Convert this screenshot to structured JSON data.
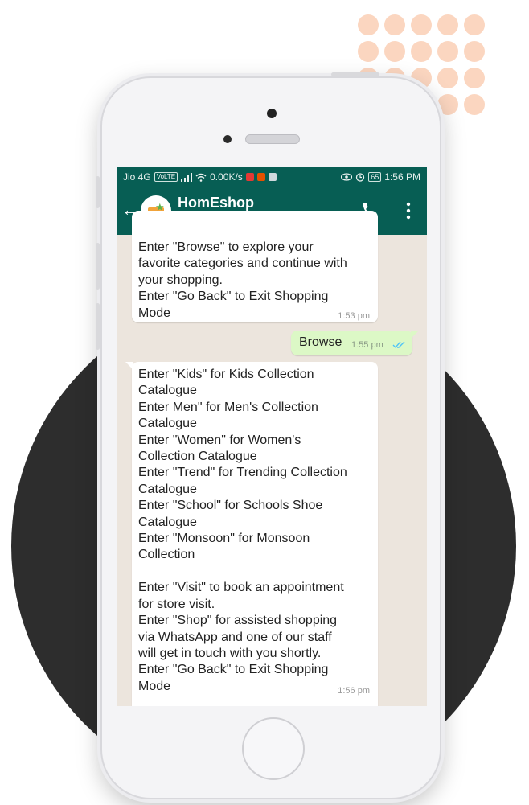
{
  "status_bar": {
    "carrier": "Jio 4G",
    "volte_badge": "VoLTE",
    "speed": "0.00K/s",
    "battery": "65",
    "time": "1:56 PM"
  },
  "header": {
    "contact_name": "HomEshop",
    "back_icon": "arrow-left-icon",
    "call_icon": "phone-icon",
    "menu_icon": "more-vert-icon"
  },
  "messages": [
    {
      "direction": "incoming",
      "lines": [
        "Enter \"Browse\" to explore your",
        "favorite categories and continue with",
        "your shopping.",
        "Enter \"Go Back\" to Exit Shopping",
        "Mode"
      ],
      "time": "1:53 pm"
    },
    {
      "direction": "outgoing",
      "text": "Browse",
      "time": "1:55 pm",
      "status": "read"
    },
    {
      "direction": "incoming",
      "lines": [
        "Enter \"Kids\" for Kids Collection",
        "Catalogue",
        "Enter Men\" for Men's Collection",
        "Catalogue",
        "Enter \"Women\" for Women's",
        "Collection Catalogue",
        "Enter \"Trend\" for Trending Collection",
        "Catalogue",
        "Enter \"School\" for Schools Shoe",
        "Catalogue",
        "Enter \"Monsoon\" for Monsoon",
        "Collection",
        " ",
        "Enter \"Visit\" to book an appointment",
        "for store visit.",
        "Enter \"Shop\" for assisted shopping",
        "via WhatsApp and one of our staff",
        "will get in touch with you shortly.",
        "Enter \"Go Back\" to Exit Shopping",
        "Mode"
      ],
      "time": "1:56 pm"
    }
  ],
  "colors": {
    "header": "#075e54",
    "chat_bg": "#ece5dd",
    "outgoing_bubble": "#dcf8c6",
    "read_ticks": "#4fc3f7",
    "decor_dots": "#fbd6c0",
    "decor_circle": "#2d2d2d"
  }
}
